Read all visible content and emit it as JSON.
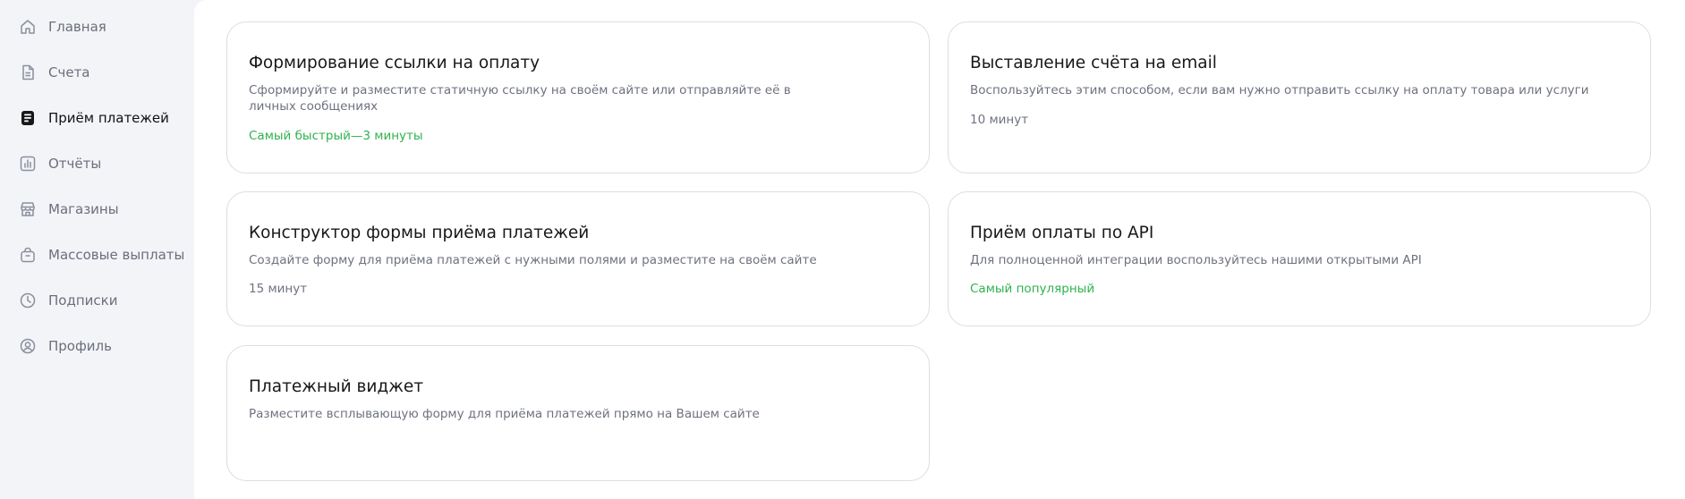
{
  "sidebar": {
    "items": [
      {
        "label": "Главная",
        "icon": "home-icon"
      },
      {
        "label": "Счета",
        "icon": "document-icon"
      },
      {
        "label": "Приём платежей",
        "icon": "payment-terminal-icon",
        "active": true
      },
      {
        "label": "Отчёты",
        "icon": "bar-chart-icon"
      },
      {
        "label": "Магазины",
        "icon": "store-icon"
      },
      {
        "label": "Массовые выплаты",
        "icon": "bag-icon"
      },
      {
        "label": "Подписки",
        "icon": "clock-icon"
      },
      {
        "label": "Профиль",
        "icon": "user-circle-icon"
      }
    ]
  },
  "cards": [
    {
      "title": "Формирование ссылки на оплату",
      "description": "Сформируйте и разместите статичную ссылку на своём сайте или отправляйте её в личных сообщениях",
      "meta": "Самый быстрый—3 минуты",
      "meta_highlight": true
    },
    {
      "title": "Выставление счёта на email",
      "description": "Воспользуйтесь этим способом, если вам нужно отправить ссылку на оплату товара или услуги",
      "meta": "10 минут",
      "meta_highlight": false
    },
    {
      "title": "Конструктор формы приёма платежей",
      "description": "Создайте форму для приёма платежей с нужными полями и разместите на своём сайте",
      "meta": "15 минут",
      "meta_highlight": false
    },
    {
      "title": "Приём оплаты по API",
      "description": "Для полноценной интеграции воспользуйтесь нашими открытыми API",
      "meta": "Самый популярный",
      "meta_highlight": true
    },
    {
      "title": "Платежный виджет",
      "description": "Разместите всплывающую форму для приёма платежей прямо на Вашем сайте"
    }
  ],
  "colors": {
    "accent_green": "#2fb24e",
    "text_muted": "#6e7280",
    "sidebar_bg": "#f3f4f8",
    "card_border": "#dcdee5"
  }
}
